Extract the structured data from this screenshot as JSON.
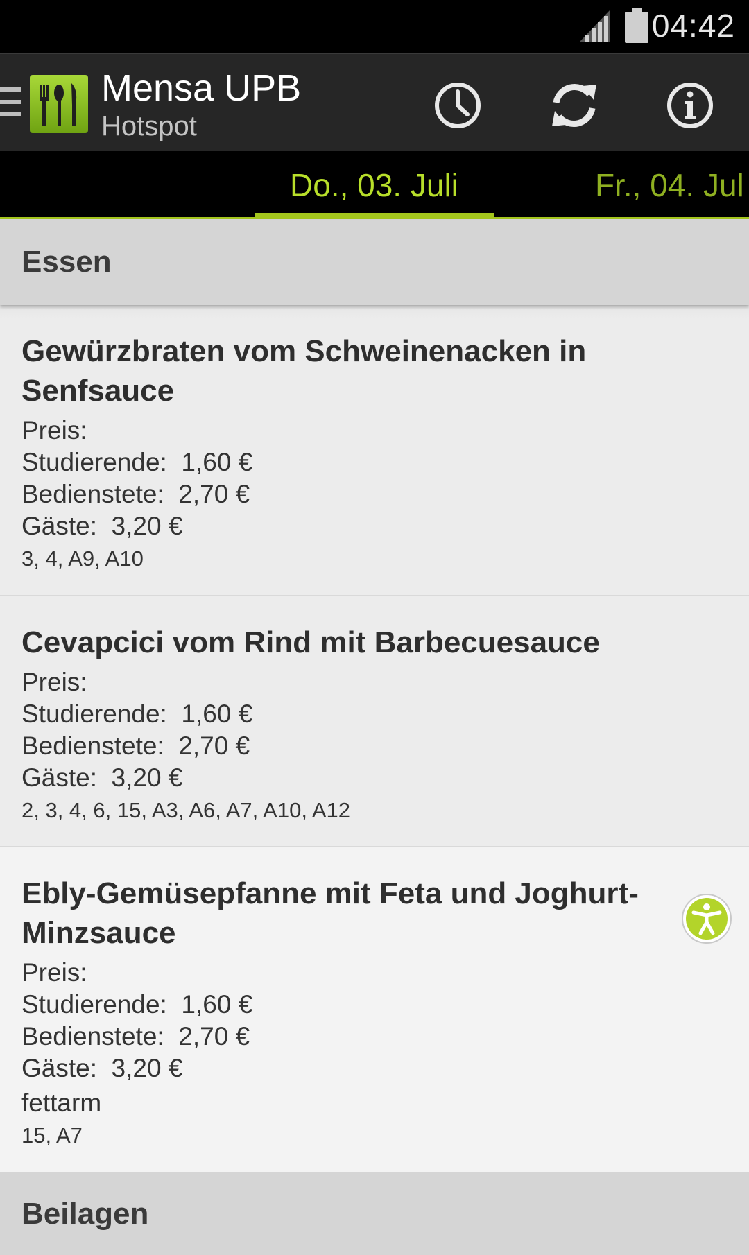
{
  "status_bar": {
    "time": "04:42",
    "icons": [
      "signal-icon",
      "battery-icon"
    ]
  },
  "action_bar": {
    "title": "Mensa UPB",
    "subtitle": "Hotspot",
    "icons": [
      "drawer-icon",
      "app-logo",
      "history-icon",
      "refresh-icon",
      "info-icon"
    ]
  },
  "tabs": {
    "active": "Do., 03. Juli",
    "next": "Fr., 04. Jul"
  },
  "sections": {
    "essen": "Essen",
    "beilagen": "Beilagen"
  },
  "meals": [
    {
      "title": "Gewürzbraten vom Schweinenacken in Senfsauce",
      "preis": "Preis:",
      "studierende": "Studierende:  1,60 €",
      "bedienstete": "Bedienstete:  2,70 €",
      "gaeste": "Gäste:  3,20 €",
      "allergens": "3, 4, A9, A10"
    },
    {
      "title": "Cevapcici vom Rind mit Barbecuesauce",
      "preis": "Preis:",
      "studierende": "Studierende:  1,60 €",
      "bedienstete": "Bedienstete:  2,70 €",
      "gaeste": "Gäste:  3,20 €",
      "allergens": "2, 3, 4, 6, 15, A3, A6, A7, A10, A12"
    },
    {
      "title": "Ebly-Gemüsepfanne mit Feta und Joghurt-Minzsauce",
      "preis": "Preis:",
      "studierende": "Studierende:  1,60 €",
      "bedienstete": "Bedienstete:  2,70 €",
      "gaeste": "Gäste:  3,20 €",
      "note": "fettarm",
      "allergens": "15, A7"
    }
  ],
  "colors": {
    "accent": "#a4c61d",
    "statusbar": "#000000",
    "actionbar": "#262626",
    "section_bg": "#d5d5d5"
  },
  "accessibility_icon": "accessibility-icon"
}
